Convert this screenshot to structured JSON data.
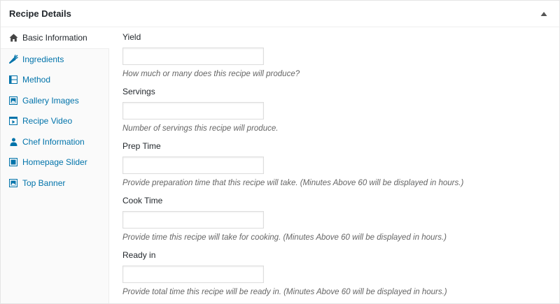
{
  "metabox": {
    "title": "Recipe Details",
    "toggle_icon": "triangle-up-icon"
  },
  "tabs": [
    {
      "label": "Basic Information",
      "icon": "home-icon",
      "active": true
    },
    {
      "label": "Ingredients",
      "icon": "carrot-icon",
      "active": false
    },
    {
      "label": "Method",
      "icon": "film-icon",
      "active": false
    },
    {
      "label": "Gallery Images",
      "icon": "gallery-icon",
      "active": false
    },
    {
      "label": "Recipe Video",
      "icon": "video-icon",
      "active": false
    },
    {
      "label": "Chef Information",
      "icon": "user-icon",
      "active": false
    },
    {
      "label": "Homepage Slider",
      "icon": "slider-icon",
      "active": false
    },
    {
      "label": "Top Banner",
      "icon": "banner-icon",
      "active": false
    }
  ],
  "fields": [
    {
      "label": "Yield",
      "value": "",
      "description": "How much or many does this recipe will produce?"
    },
    {
      "label": "Servings",
      "value": "",
      "description": "Number of servings this recipe will produce."
    },
    {
      "label": "Prep Time",
      "value": "",
      "description": "Provide preparation time that this recipe will take. (Minutes Above 60 will be displayed in hours.)"
    },
    {
      "label": "Cook Time",
      "value": "",
      "description": "Provide time this recipe will take for cooking. (Minutes Above 60 will be displayed in hours.)"
    },
    {
      "label": "Ready in",
      "value": "",
      "description": "Provide total time this recipe will be ready in. (Minutes Above 60 will be displayed in hours.)"
    }
  ],
  "colors": {
    "link": "#0073aa",
    "text": "#23282d",
    "muted": "#666666"
  }
}
